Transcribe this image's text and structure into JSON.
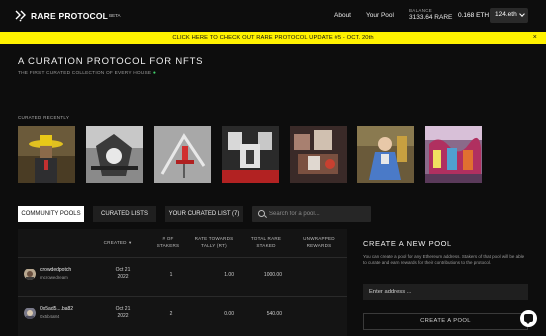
{
  "nav": {
    "logo_text": "RARE PROTOCOL",
    "logo_beta": "BETA",
    "about": "About",
    "your_pool": "Your Pool",
    "balance_label": "BALANCE",
    "balance_value": "3133.64 RARE",
    "eth_balance": "0.168 ETH",
    "ens_name": "124.eth"
  },
  "banner": {
    "text": "CLICK HERE TO CHECK OUT RARE PROTOCOL UPDATE #5 - OCT. 20th",
    "close": "×"
  },
  "header": {
    "title": "A CURATION PROTOCOL FOR NFTS",
    "subtitle": "THE FIRST CURATED COLLECTION OF EVERY HOUSE",
    "carousel_label": "CURATED RECENTLY"
  },
  "tabs": {
    "community": "COMMUNITY POOLS",
    "curated": "CURATED LISTS",
    "your_list": "YOUR CURATED LIST (7)"
  },
  "search": {
    "placeholder": "Search for a pool..."
  },
  "table": {
    "headers": {
      "created": "CREATED",
      "stakers": "# OF STAKERS",
      "rate": "RATE TOWARDS TALLY (RT)",
      "total": "TOTAL RARE STAKED",
      "unwrapped": "UNWRAPPED REWARDS"
    },
    "rows": [
      {
        "name": "crowdedpotch",
        "owner": "mcrowedream",
        "created": "Oct 21 2022",
        "stakers": "1",
        "rate": "1.00",
        "total": "1000.00",
        "unwrapped": ""
      },
      {
        "name": "0x5ad5....ba82",
        "owner": "0x5b4a84",
        "created": "Oct 21 2022",
        "stakers": "2",
        "rate": "0.00",
        "total": "540.00",
        "unwrapped": ""
      }
    ]
  },
  "create_pool": {
    "title": "CREATE A NEW POOL",
    "description": "You can create a pool for any Ethereum address. Stakers of that pool will be able to curate and earn rewards for their contributions to the protocol.",
    "input_placeholder": "Enter address ...",
    "button": "CREATE A POOL"
  },
  "colors": {
    "banner": "#fff200",
    "background": "#0d0d0d",
    "accent_green": "#3fd06b"
  }
}
